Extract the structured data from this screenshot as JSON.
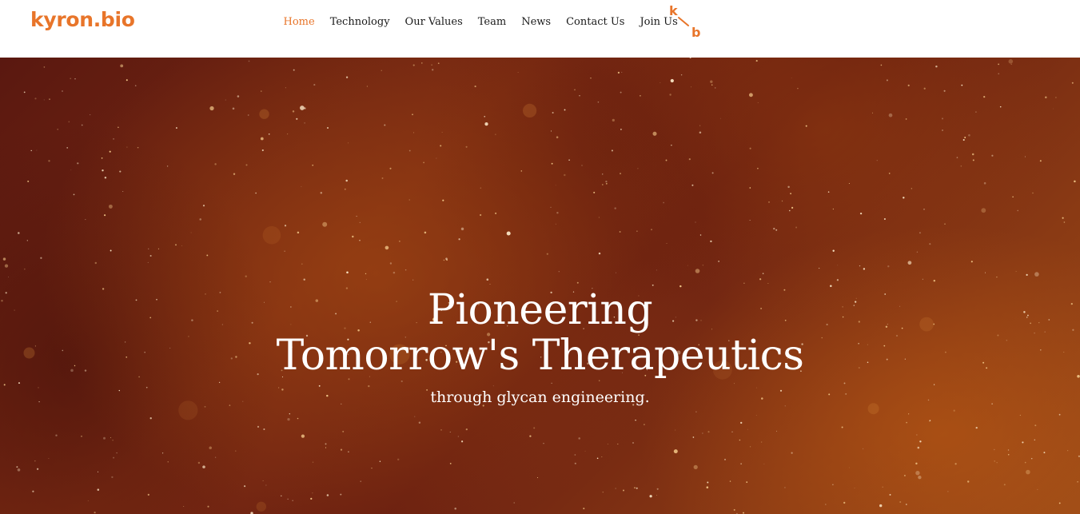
{
  "header": {
    "brand": "kyron.bio",
    "brand_color": "#e8752a",
    "nav_items": [
      {
        "label": "Home",
        "active": true
      },
      {
        "label": "Technology",
        "active": false
      },
      {
        "label": "Our Values",
        "active": false
      },
      {
        "label": "Team",
        "active": false
      },
      {
        "label": "News",
        "active": false
      },
      {
        "label": "Contact Us",
        "active": false
      },
      {
        "label": "Join Us",
        "active": false
      }
    ],
    "active_color": "#e8752a",
    "logo_icon": "kb-monogram-icon",
    "logo_letters": {
      "top": "k",
      "bottom": "b"
    }
  },
  "hero": {
    "headline_line1": "Pioneering",
    "headline_line2": "Tomorrow's Therapeutics",
    "subhead": "through glycan engineering.",
    "background": "orange-brown particle dust"
  }
}
